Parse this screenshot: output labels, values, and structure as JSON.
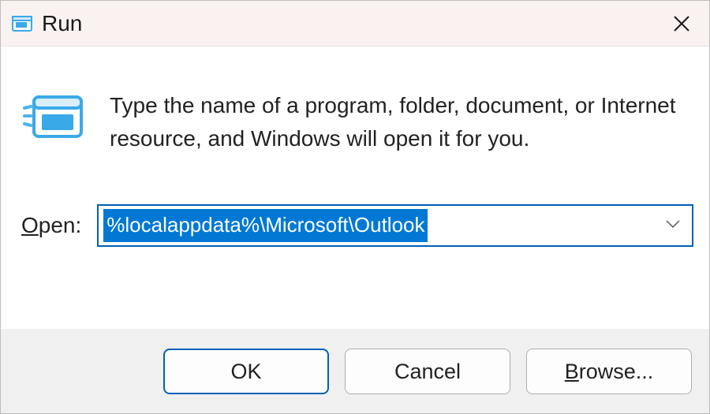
{
  "titlebar": {
    "title": "Run"
  },
  "content": {
    "description": "Type the name of a program, folder, document, or Internet resource, and Windows will open it for you.",
    "open_label_underlined": "O",
    "open_label_rest": "pen:",
    "open_value": "%localappdata%\\Microsoft\\Outlook"
  },
  "buttons": {
    "ok": "OK",
    "cancel": "Cancel",
    "browse_underlined": "B",
    "browse_rest": "rowse..."
  }
}
